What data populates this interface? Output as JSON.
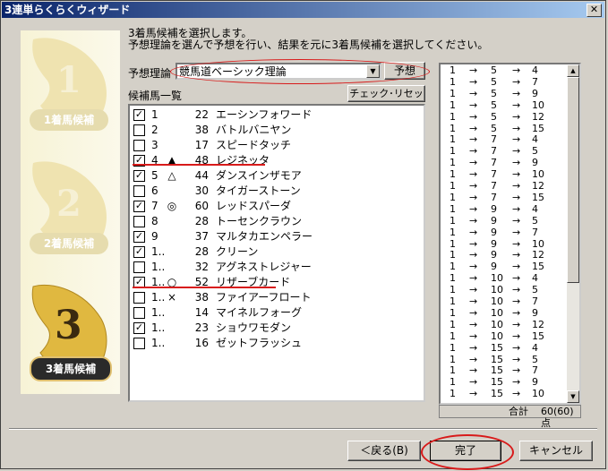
{
  "window": {
    "title": "3連単らくらくウィザード",
    "close_glyph": "✕"
  },
  "steps": [
    {
      "number": "1",
      "label": "1着馬候補"
    },
    {
      "number": "2",
      "label": "2着馬候補"
    },
    {
      "number": "3",
      "label": "3着馬候補"
    }
  ],
  "instructions": {
    "line1": "3着馬候補を選択します。",
    "line2": "予想理論を選んで予想を行い、結果を元に3着馬候補を選択してください。"
  },
  "theory": {
    "label": "予想理論",
    "selected": "競馬道ベーシック理論",
    "predict_button": "予想"
  },
  "horse_list": {
    "title": "候補馬一覧",
    "reset_button": "チェック･リセット",
    "rows": [
      {
        "check": "✓",
        "no": "1",
        "mark": "",
        "num": "22",
        "name": "エーシンフォワード"
      },
      {
        "check": "",
        "no": "2",
        "mark": "",
        "num": "38",
        "name": "バトルバニヤン"
      },
      {
        "check": "",
        "no": "3",
        "mark": "",
        "num": "17",
        "name": "スピードタッチ"
      },
      {
        "check": "✓",
        "no": "4",
        "mark": "▲",
        "num": "48",
        "name": "レジネッタ"
      },
      {
        "check": "✓",
        "no": "5",
        "mark": "△",
        "num": "44",
        "name": "ダンスインザモア"
      },
      {
        "check": "",
        "no": "6",
        "mark": "",
        "num": "30",
        "name": "タイガーストーン"
      },
      {
        "check": "✓",
        "no": "7",
        "mark": "◎",
        "num": "60",
        "name": "レッドスパーダ"
      },
      {
        "check": "",
        "no": "8",
        "mark": "",
        "num": "28",
        "name": "トーセンクラウン"
      },
      {
        "check": "✓",
        "no": "9",
        "mark": "",
        "num": "37",
        "name": "マルタカエンペラー"
      },
      {
        "check": "✓",
        "no": "1..",
        "mark": "",
        "num": "28",
        "name": "クリーン"
      },
      {
        "check": "",
        "no": "1..",
        "mark": "",
        "num": "32",
        "name": "アグネストレジャー"
      },
      {
        "check": "✓",
        "no": "1..",
        "mark": "○",
        "num": "52",
        "name": "リザーブカード"
      },
      {
        "check": "",
        "no": "1..",
        "mark": "×",
        "num": "38",
        "name": "ファイアーフロート"
      },
      {
        "check": "",
        "no": "1..",
        "mark": "",
        "num": "14",
        "name": "マイネルフォーグ"
      },
      {
        "check": "✓",
        "no": "1..",
        "mark": "",
        "num": "23",
        "name": "ショウワモダン"
      },
      {
        "check": "",
        "no": "1..",
        "mark": "",
        "num": "16",
        "name": "ゼットフラッシュ"
      }
    ]
  },
  "combinations": {
    "arrow": "→",
    "rows": [
      [
        "1",
        "5",
        "4"
      ],
      [
        "1",
        "5",
        "7"
      ],
      [
        "1",
        "5",
        "9"
      ],
      [
        "1",
        "5",
        "10"
      ],
      [
        "1",
        "5",
        "12"
      ],
      [
        "1",
        "5",
        "15"
      ],
      [
        "1",
        "7",
        "4"
      ],
      [
        "1",
        "7",
        "5"
      ],
      [
        "1",
        "7",
        "9"
      ],
      [
        "1",
        "7",
        "10"
      ],
      [
        "1",
        "7",
        "12"
      ],
      [
        "1",
        "7",
        "15"
      ],
      [
        "1",
        "9",
        "4"
      ],
      [
        "1",
        "9",
        "5"
      ],
      [
        "1",
        "9",
        "7"
      ],
      [
        "1",
        "9",
        "10"
      ],
      [
        "1",
        "9",
        "12"
      ],
      [
        "1",
        "9",
        "15"
      ],
      [
        "1",
        "10",
        "4"
      ],
      [
        "1",
        "10",
        "5"
      ],
      [
        "1",
        "10",
        "7"
      ],
      [
        "1",
        "10",
        "9"
      ],
      [
        "1",
        "10",
        "12"
      ],
      [
        "1",
        "10",
        "15"
      ],
      [
        "1",
        "15",
        "4"
      ],
      [
        "1",
        "15",
        "5"
      ],
      [
        "1",
        "15",
        "7"
      ],
      [
        "1",
        "15",
        "9"
      ],
      [
        "1",
        "15",
        "10"
      ]
    ],
    "total_label": "合計",
    "total_value": "60(60)点"
  },
  "footer": {
    "back_button": "＜戻る(B)",
    "finish_button": "完了",
    "cancel_button": "キャンセル"
  },
  "colors": {
    "title_start": "#0a246a",
    "title_end": "#a6caf0",
    "highlight_red": "#d81a1a",
    "step_gold": "#e0b840"
  }
}
